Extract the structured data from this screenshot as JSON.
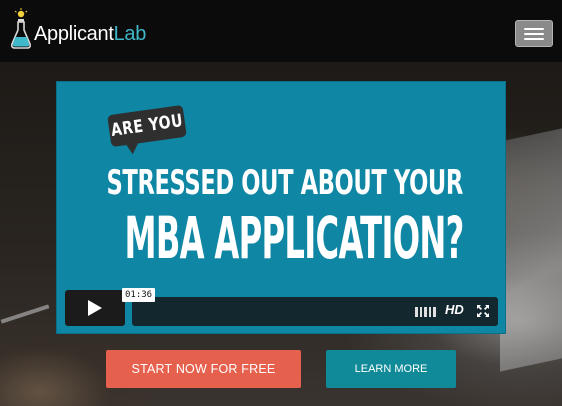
{
  "header": {
    "logo_primary": "Applicant",
    "logo_accent": "Lab",
    "menu_icon": "hamburger-menu-icon",
    "brand_color": "#3fb8c9"
  },
  "video": {
    "bubble_text": "ARE YOU",
    "headline_line1": "STRESSED OUT ABOUT YOUR",
    "headline_line2": "MBA APPLICATION?",
    "background_color": "#0f86a4",
    "timecode": "01:36",
    "quality_label": "HD",
    "play_icon": "play-icon",
    "volume_icon": "volume-icon",
    "fullscreen_icon": "fullscreen-icon"
  },
  "cta": {
    "start_label": "START NOW FOR FREE",
    "start_color": "#e6604e",
    "learn_label": "LEARN MORE",
    "learn_color": "#108a99"
  }
}
